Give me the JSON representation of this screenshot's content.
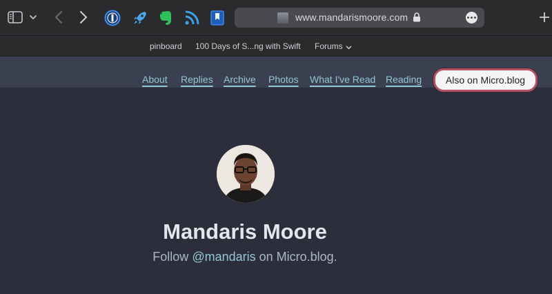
{
  "browser": {
    "url": "www.mandarismoore.com",
    "icons": [
      "sidebar-icon",
      "chevron-down-icon",
      "back-icon",
      "forward-icon",
      "1password-icon",
      "rocket-icon",
      "evernote-icon",
      "rss-icon",
      "bookmark-icon",
      "lock-icon",
      "more-icon",
      "plus-icon"
    ]
  },
  "bookmarks": {
    "items": [
      "pinboard",
      "100 Days of S...ng with Swift",
      "Forums"
    ]
  },
  "nav": {
    "links": [
      "About",
      "Replies",
      "Archive",
      "Photos",
      "What I've Read",
      "Reading"
    ],
    "micro_button": "Also on Micro.blog"
  },
  "profile": {
    "name": "Mandaris Moore",
    "follow_prefix": "Follow ",
    "handle": "@mandaris",
    "follow_suffix": " on Micro.blog."
  },
  "colors": {
    "page_bg": "#2c2f3b",
    "nav_bg": "#3b4050",
    "link": "#94c7d6",
    "button_border": "#b7515f"
  }
}
